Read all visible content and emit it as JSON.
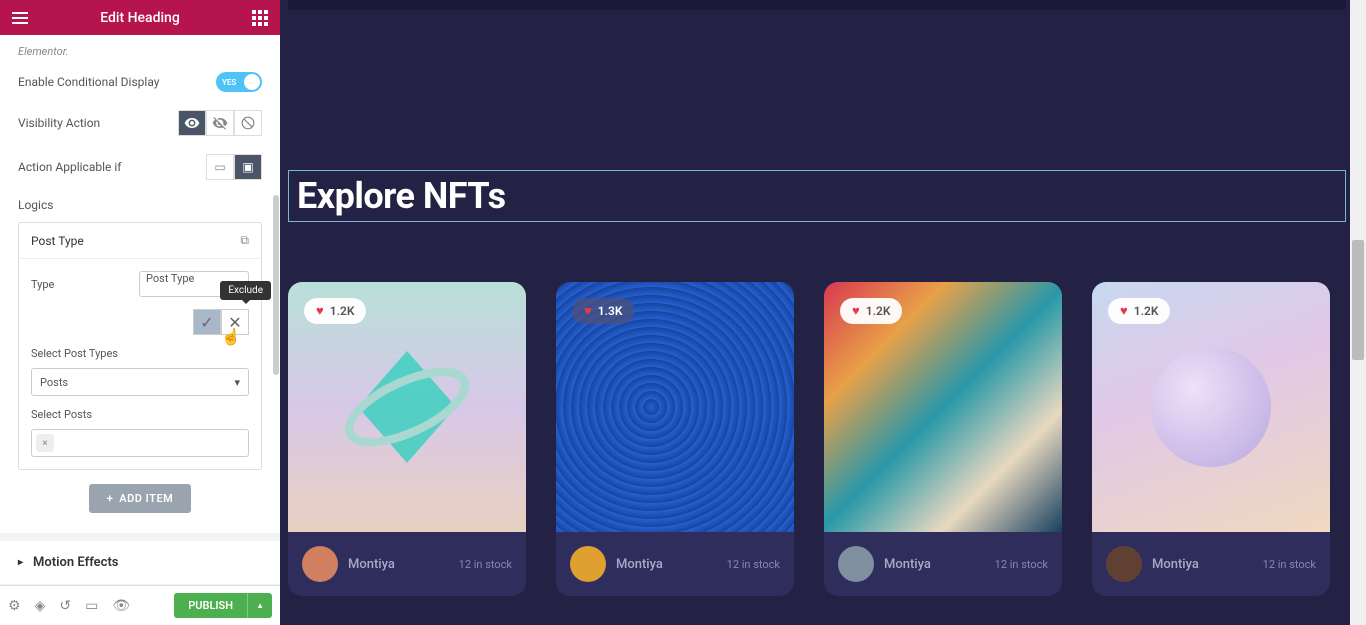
{
  "sidebar": {
    "title": "Edit Heading",
    "help_text": "Elementor.",
    "enable_conditional_label": "Enable Conditional Display",
    "toggle_yes": "YES",
    "visibility_action_label": "Visibility Action",
    "action_applicable_label": "Action Applicable if",
    "logics_label": "Logics",
    "repeater_title": "Post Type",
    "type_label": "Type",
    "type_value": "Post Type",
    "tooltip_exclude": "Exclude",
    "select_post_types_label": "Select Post Types",
    "select_post_types_value": "Posts",
    "select_posts_label": "Select Posts",
    "add_item_label": "ADD ITEM",
    "motion_effects_label": "Motion Effects",
    "publish_label": "PUBLISH"
  },
  "preview": {
    "heading": "Explore NFTs",
    "cards": [
      {
        "likes": "1.2K",
        "author": "Montiya",
        "stock": "12 in stock",
        "badge_dark": false
      },
      {
        "likes": "1.3K",
        "author": "Montiya",
        "stock": "12 in stock",
        "badge_dark": true
      },
      {
        "likes": "1.2K",
        "author": "Montiya",
        "stock": "12 in stock",
        "badge_dark": false
      },
      {
        "likes": "1.2K",
        "author": "Montiya",
        "stock": "12 in stock",
        "badge_dark": false
      }
    ]
  }
}
